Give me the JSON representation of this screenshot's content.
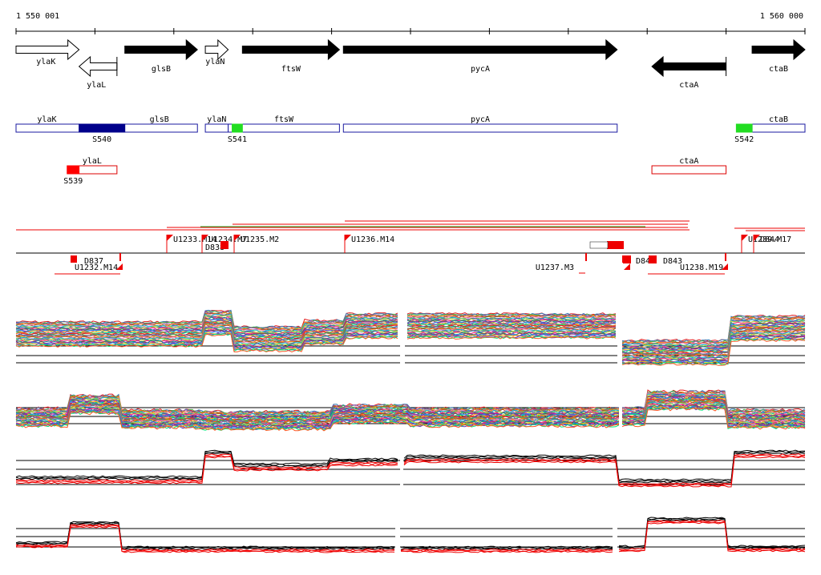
{
  "coords": {
    "start_label": "1 550 001",
    "end_label": "1 560 000",
    "start": 1550001,
    "end": 1560000
  },
  "genes": [
    {
      "name": "ylaK",
      "start": 1550001,
      "end": 1550800,
      "strand": "+",
      "fill": "white"
    },
    {
      "name": "ylaL",
      "start": 1550800,
      "end": 1551280,
      "strand": "-",
      "fill": "white"
    },
    {
      "name": "glsB",
      "start": 1551380,
      "end": 1552300,
      "strand": "+",
      "fill": "black"
    },
    {
      "name": "ylaN",
      "start": 1552400,
      "end": 1552690,
      "strand": "+",
      "fill": "white"
    },
    {
      "name": "ftsW",
      "start": 1552870,
      "end": 1554100,
      "strand": "+",
      "fill": "black"
    },
    {
      "name": "pycA",
      "start": 1554150,
      "end": 1557620,
      "strand": "+",
      "fill": "black"
    },
    {
      "name": "ctaA",
      "start": 1558060,
      "end": 1559000,
      "strand": "-",
      "fill": "black"
    },
    {
      "name": "ctaB",
      "start": 1559330,
      "end": 1560000,
      "strand": "+",
      "fill": "black"
    }
  ],
  "segment_rows": [
    {
      "boxes": [
        {
          "start": 1550001,
          "end": 1552300,
          "color": "#1a1aa0",
          "labels": [
            "ylaK",
            "glsB"
          ]
        },
        {
          "start": 1552400,
          "end": 1552690,
          "color": "#1a1aa0",
          "labels": [
            "ylaN"
          ]
        },
        {
          "start": 1552690,
          "end": 1554100,
          "color": "#1a1aa0",
          "labels": [
            "ftsW"
          ]
        },
        {
          "start": 1554150,
          "end": 1557620,
          "color": "#1a1aa0",
          "labels": [
            "pycA"
          ]
        },
        {
          "start": 1559330,
          "end": 1560000,
          "color": "#1a1aa0",
          "labels": [
            "ctaB"
          ]
        }
      ],
      "segments": [
        {
          "name": "S540",
          "start": 1550800,
          "end": 1551380,
          "color": "#00008b"
        },
        {
          "name": "S541",
          "start": 1552740,
          "end": 1552870,
          "color": "#22dd22"
        },
        {
          "name": "S542",
          "start": 1559130,
          "end": 1559330,
          "color": "#22dd22"
        }
      ]
    },
    {
      "boxes": [
        {
          "start": 1550650,
          "end": 1551280,
          "color": "#dd0000",
          "labels": [
            "ylaL"
          ]
        },
        {
          "start": 1558060,
          "end": 1559000,
          "color": "#dd0000",
          "labels": [
            "ctaA"
          ]
        }
      ],
      "segments": [
        {
          "name": "S539",
          "start": 1550650,
          "end": 1550800,
          "color": "#ff0000"
        }
      ]
    }
  ],
  "features": [
    {
      "name": "U1233.M14",
      "above": true
    },
    {
      "name": "U1234.M7",
      "above": true
    },
    {
      "name": "D838",
      "above": true
    },
    {
      "name": "U1235.M2",
      "above": true
    },
    {
      "name": "U1236.M14",
      "above": true
    },
    {
      "name": "D837",
      "above": false
    },
    {
      "name": "U1232.M14",
      "above": false
    },
    {
      "name": "U1237.M3",
      "above": false
    },
    {
      "name": "D841",
      "above": false
    },
    {
      "name": "D843",
      "above": false
    },
    {
      "name": "U1238.M19",
      "above": false
    },
    {
      "name": "U1239.M17",
      "above": true
    },
    {
      "name": "D844",
      "above": true
    }
  ],
  "colors": {
    "axis": "#000000",
    "feature": "#ee0000",
    "forward_line": "#ee0000",
    "reverse_line": "#22aa22"
  }
}
